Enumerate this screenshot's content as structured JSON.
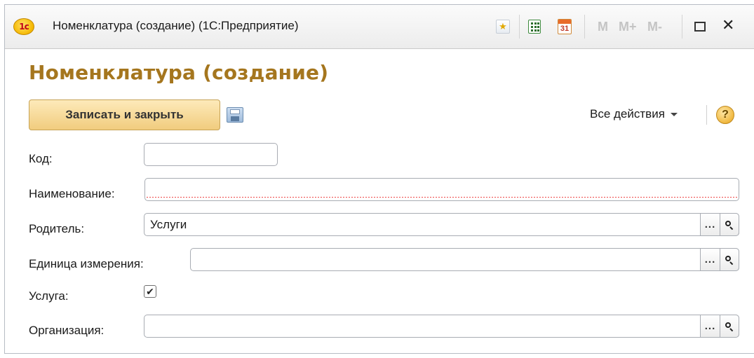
{
  "window": {
    "title": "Номенклатура (создание)  (1С:Предприятие)",
    "logo_text": "1с",
    "memory_buttons": [
      "M",
      "M+",
      "M-"
    ],
    "calendar_day": "31",
    "icons": [
      "favorite-icon",
      "calculator-icon",
      "calendar-icon",
      "maximize-icon",
      "close-icon"
    ]
  },
  "form": {
    "title": "Номенклатура (создание)",
    "save_close_label": "Записать и закрыть",
    "all_actions_label": "Все действия",
    "help_label": "?"
  },
  "fields": {
    "code": {
      "label": "Код:",
      "value": ""
    },
    "name": {
      "label": "Наименование:",
      "value": ""
    },
    "parent": {
      "label": "Родитель:",
      "value": "Услуги"
    },
    "unit": {
      "label": "Единица измерения:",
      "value": ""
    },
    "service": {
      "label": "Услуга:",
      "checked": true
    },
    "organization": {
      "label": "Организация:",
      "value": ""
    }
  },
  "colors": {
    "title": "#a5761e",
    "primary_button": "#f1cc7e",
    "required_underline": "#e44444"
  },
  "glyphs": {
    "dots": "...",
    "check": "✔"
  }
}
